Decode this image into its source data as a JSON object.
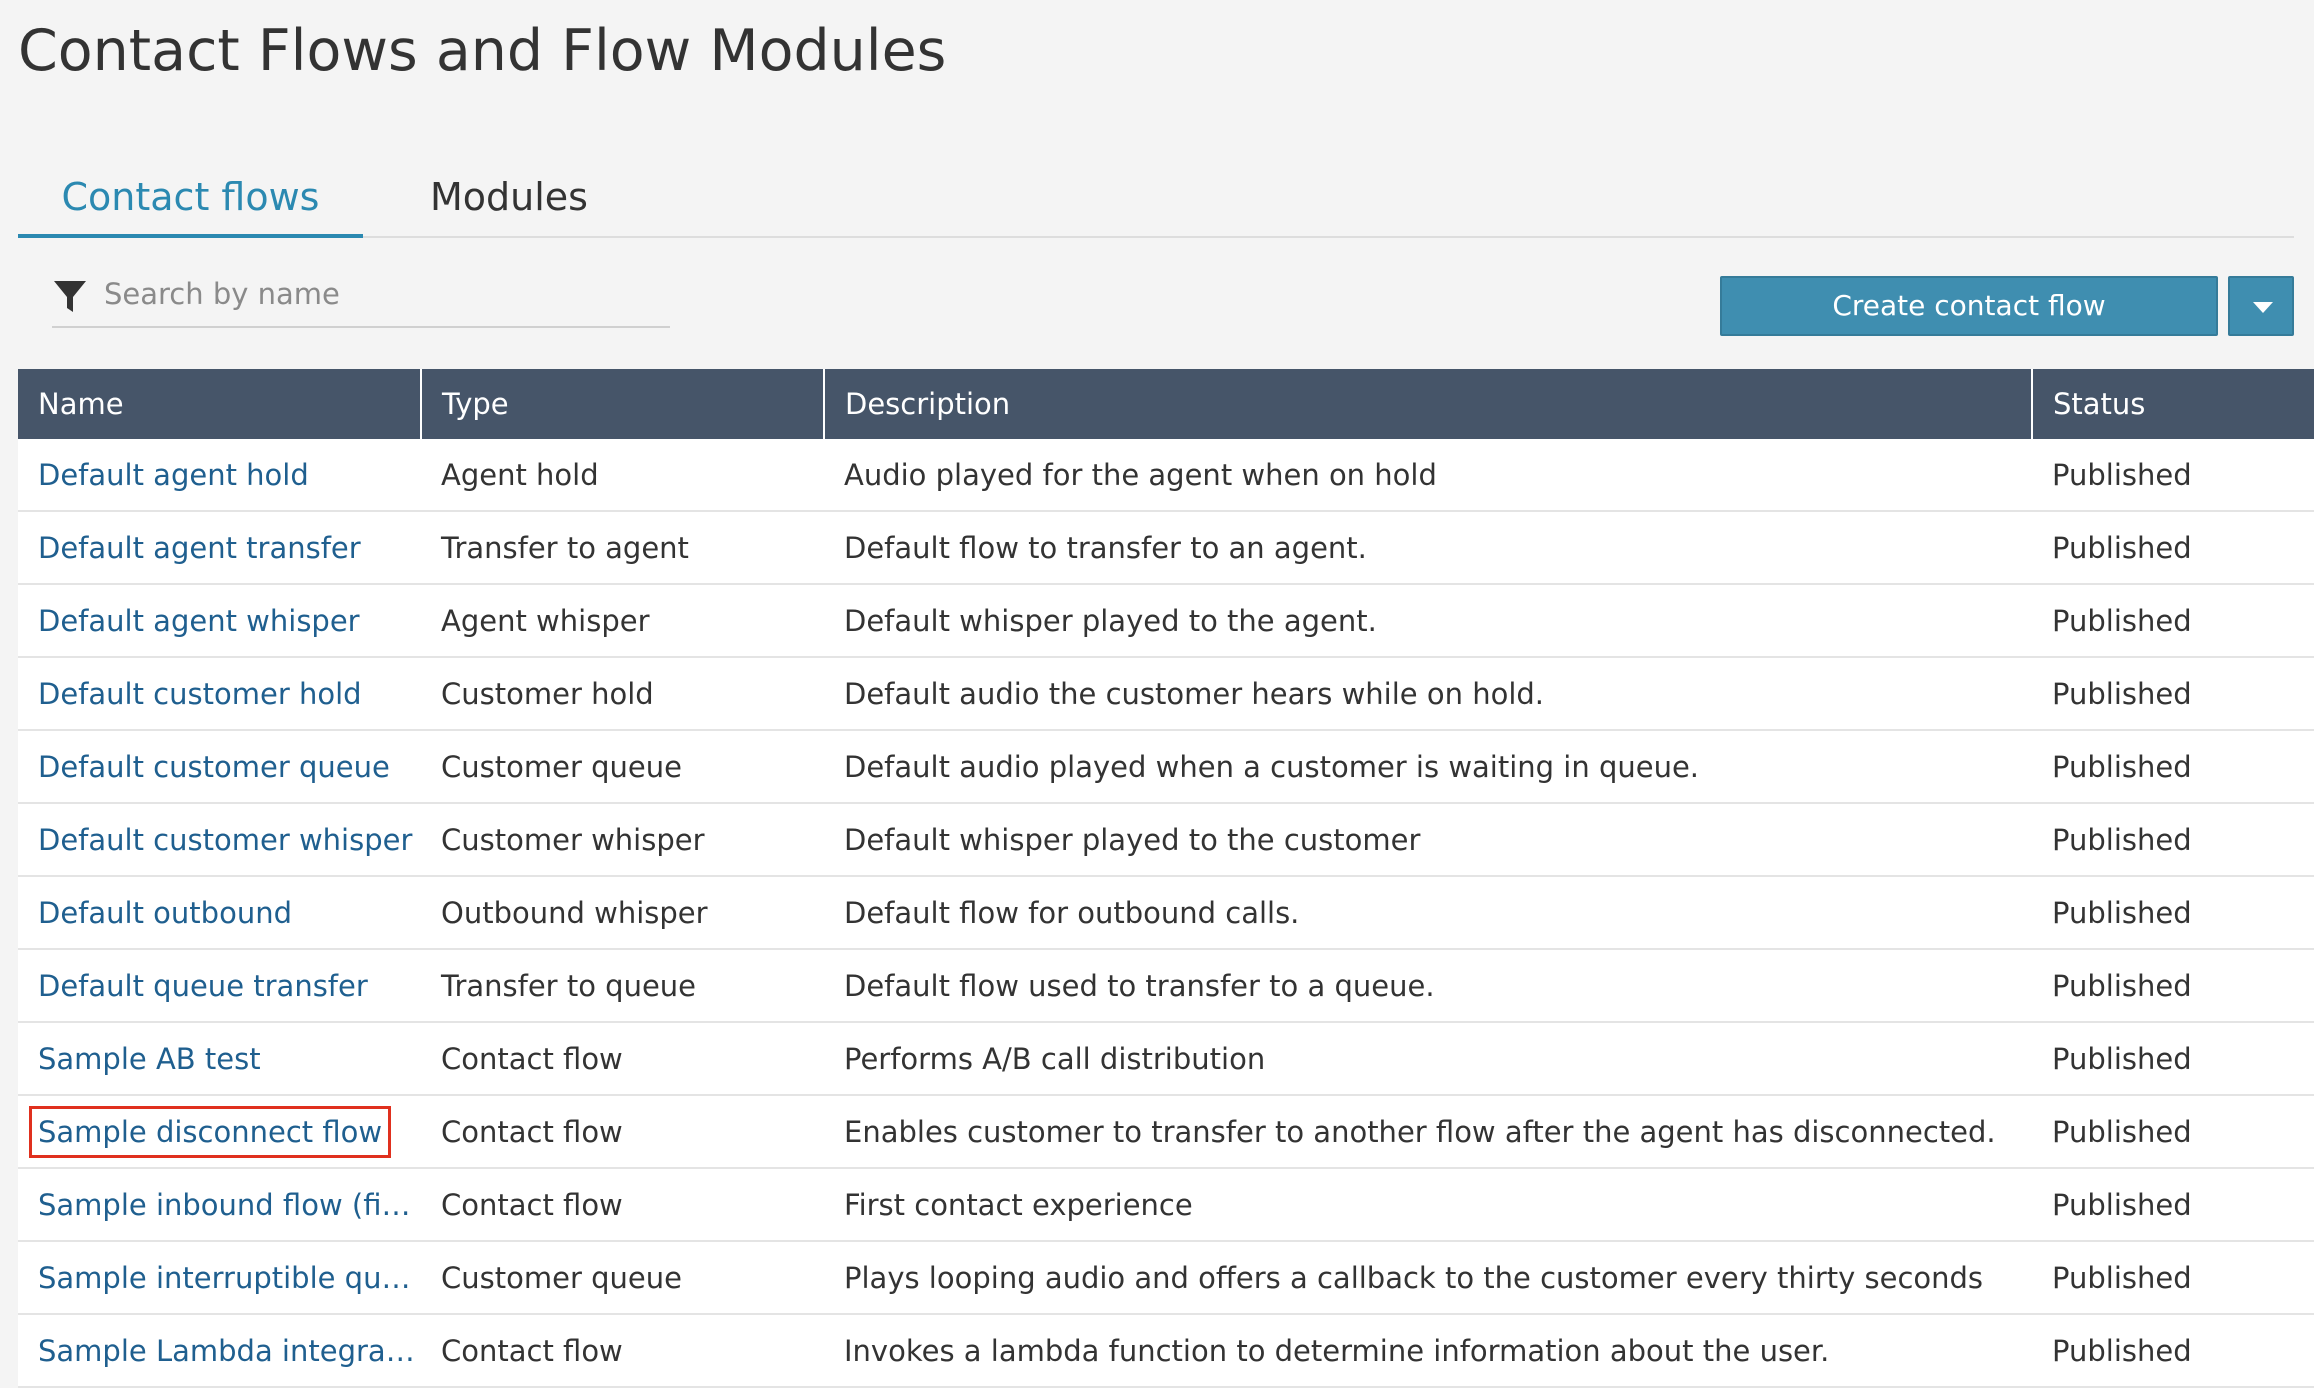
{
  "page": {
    "title": "Contact Flows and Flow Modules"
  },
  "tabs": [
    {
      "label": "Contact flows",
      "active": true
    },
    {
      "label": "Modules",
      "active": false
    }
  ],
  "search": {
    "placeholder": "Search by name",
    "value": "",
    "icon": "filter-icon"
  },
  "toolbar": {
    "create_label": "Create contact flow",
    "dropdown_icon": "caret-down-icon"
  },
  "table": {
    "columns": [
      "Name",
      "Type",
      "Description",
      "Status"
    ],
    "rows": [
      {
        "name": "Default agent hold",
        "type": "Agent hold",
        "description": "Audio played for the agent when on hold",
        "status": "Published"
      },
      {
        "name": "Default agent transfer",
        "type": "Transfer to agent",
        "description": "Default flow to transfer to an agent.",
        "status": "Published"
      },
      {
        "name": "Default agent whisper",
        "type": "Agent whisper",
        "description": "Default whisper played to the agent.",
        "status": "Published"
      },
      {
        "name": "Default customer hold",
        "type": "Customer hold",
        "description": "Default audio the customer hears while on hold.",
        "status": "Published"
      },
      {
        "name": "Default customer queue",
        "type": "Customer queue",
        "description": "Default audio played when a customer is waiting in queue.",
        "status": "Published"
      },
      {
        "name": "Default customer whisper",
        "type": "Customer whisper",
        "description": "Default whisper played to the customer",
        "status": "Published"
      },
      {
        "name": "Default outbound",
        "type": "Outbound whisper",
        "description": "Default flow for outbound calls.",
        "status": "Published"
      },
      {
        "name": "Default queue transfer",
        "type": "Transfer to queue",
        "description": "Default flow used to transfer to a queue.",
        "status": "Published"
      },
      {
        "name": "Sample AB test",
        "type": "Contact flow",
        "description": "Performs A/B call distribution",
        "status": "Published"
      },
      {
        "name": "Sample disconnect flow",
        "type": "Contact flow",
        "description": "Enables customer to transfer to another flow after the agent has disconnected.",
        "status": "Published",
        "highlighted": true
      },
      {
        "name": "Sample inbound flow (fir…",
        "type": "Contact flow",
        "description": "First contact experience",
        "status": "Published"
      },
      {
        "name": "Sample interruptible qu…",
        "type": "Customer queue",
        "description": "Plays looping audio and offers a callback to the customer every thirty seconds",
        "status": "Published"
      },
      {
        "name": "Sample Lambda integrat…",
        "type": "Contact flow",
        "description": "Invokes a lambda function to determine information about the user.",
        "status": "Published"
      }
    ]
  },
  "colors": {
    "accent": "#2b89b1",
    "button": "#3f8eb0",
    "header_bg": "#465569",
    "link": "#1f5f8f",
    "highlight": "#e0301e"
  }
}
